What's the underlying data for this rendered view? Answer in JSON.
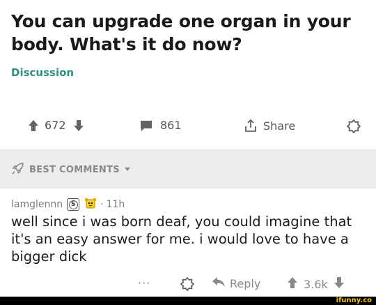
{
  "post": {
    "title": "You can upgrade one organ in your body. What's it do now?",
    "flair": "Discussion",
    "flair_color": "#2f8f7f"
  },
  "actions": {
    "upvotes": "672",
    "comments": "861",
    "share_label": "Share"
  },
  "sort": {
    "label": "BEST COMMENTS"
  },
  "comment": {
    "author": "lamglennn",
    "badge_letter": "S",
    "dot": "·",
    "age": "11h",
    "body": "well since i was born deaf, you could imagine that it's an easy answer for me. i would love to have a bigger dick",
    "more": "···",
    "reply_label": "Reply",
    "score": "3.6k"
  },
  "watermark": "ifunny.co",
  "colors": {
    "background": "#ffffff",
    "sort_bar": "#ededed",
    "muted": "#878a8c",
    "watermark": "#f7c900"
  },
  "icons": [
    "upvote-icon",
    "downvote-icon",
    "comment-icon",
    "share-icon",
    "award-icon",
    "rocket-icon",
    "chevron-down-icon",
    "reply-icon"
  ]
}
